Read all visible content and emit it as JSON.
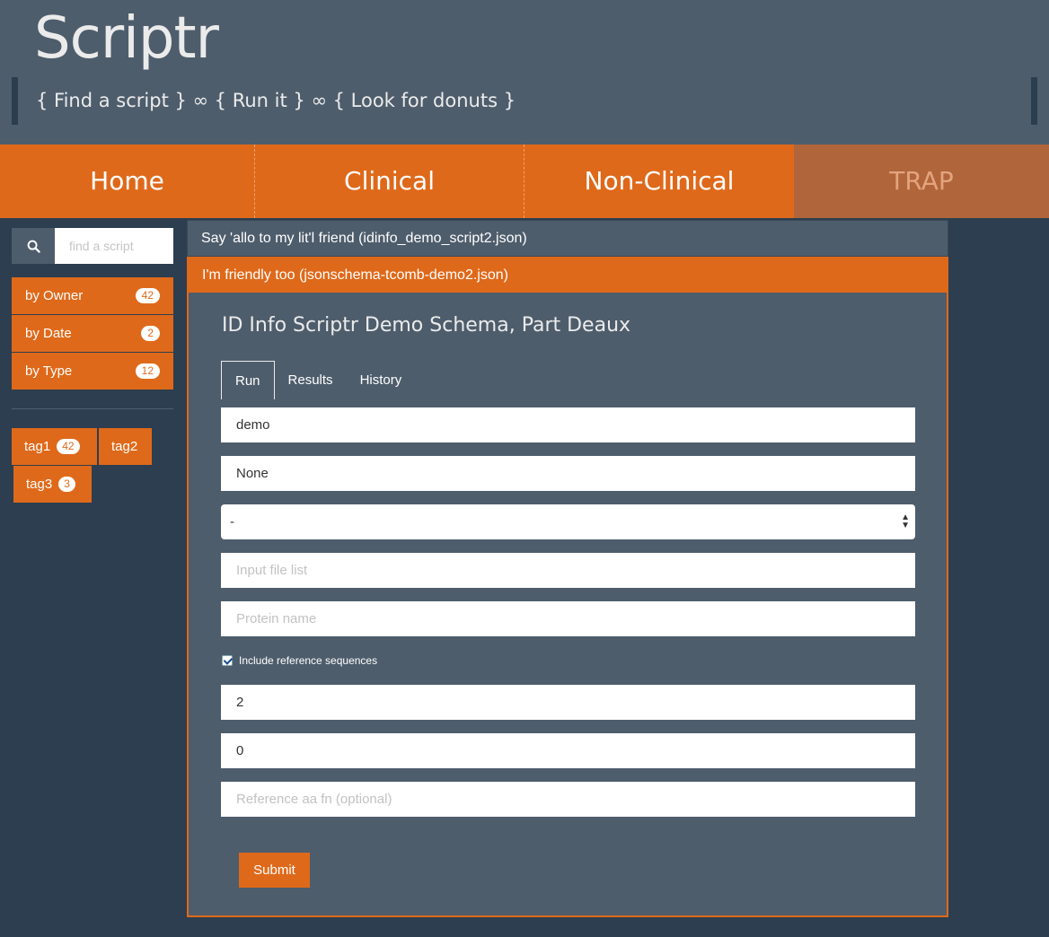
{
  "app": {
    "title": "Scriptr",
    "tagline": "{ Find a script } ∞ { Run it } ∞ { Look for donuts }"
  },
  "nav": {
    "items": [
      {
        "label": "Home"
      },
      {
        "label": "Clinical"
      },
      {
        "label": "Non-Clinical"
      },
      {
        "label": "TRAP"
      }
    ]
  },
  "sidebar": {
    "search": {
      "placeholder": "find a script",
      "icon": "search-icon"
    },
    "filters": [
      {
        "label": "by Owner",
        "count": "42"
      },
      {
        "label": "by Date",
        "count": "2"
      },
      {
        "label": "by Type",
        "count": "12"
      }
    ],
    "tags": [
      {
        "label": "tag1",
        "count": "42"
      },
      {
        "label": "tag2",
        "count": ""
      },
      {
        "label": "tag3",
        "count": "3"
      }
    ]
  },
  "scripts": {
    "collapsed": {
      "label": "Say 'allo to my lit'l friend (idinfo_demo_script2.json)"
    },
    "open": {
      "label": "I'm friendly too (jsonschema-tcomb-demo2.json)"
    }
  },
  "form": {
    "title": "ID Info Scriptr Demo Schema, Part Deaux",
    "tabs": [
      {
        "label": "Run",
        "active": true
      },
      {
        "label": "Results",
        "active": false
      },
      {
        "label": "History",
        "active": false
      }
    ],
    "field1": {
      "value": "demo"
    },
    "field2": {
      "value": "None"
    },
    "select": {
      "value": "-"
    },
    "input_file_list": {
      "placeholder": "Input file list"
    },
    "protein_name": {
      "placeholder": "Protein name"
    },
    "include_ref": {
      "label": "Include reference sequences",
      "checked": true
    },
    "field3": {
      "value": "2"
    },
    "field4": {
      "value": "0"
    },
    "ref_aa_fn": {
      "placeholder": "Reference aa fn (optional)"
    },
    "submit_label": "Submit"
  },
  "colors": {
    "accent": "#df691a",
    "background": "#2c3e50",
    "panel": "#4e5d6c"
  }
}
